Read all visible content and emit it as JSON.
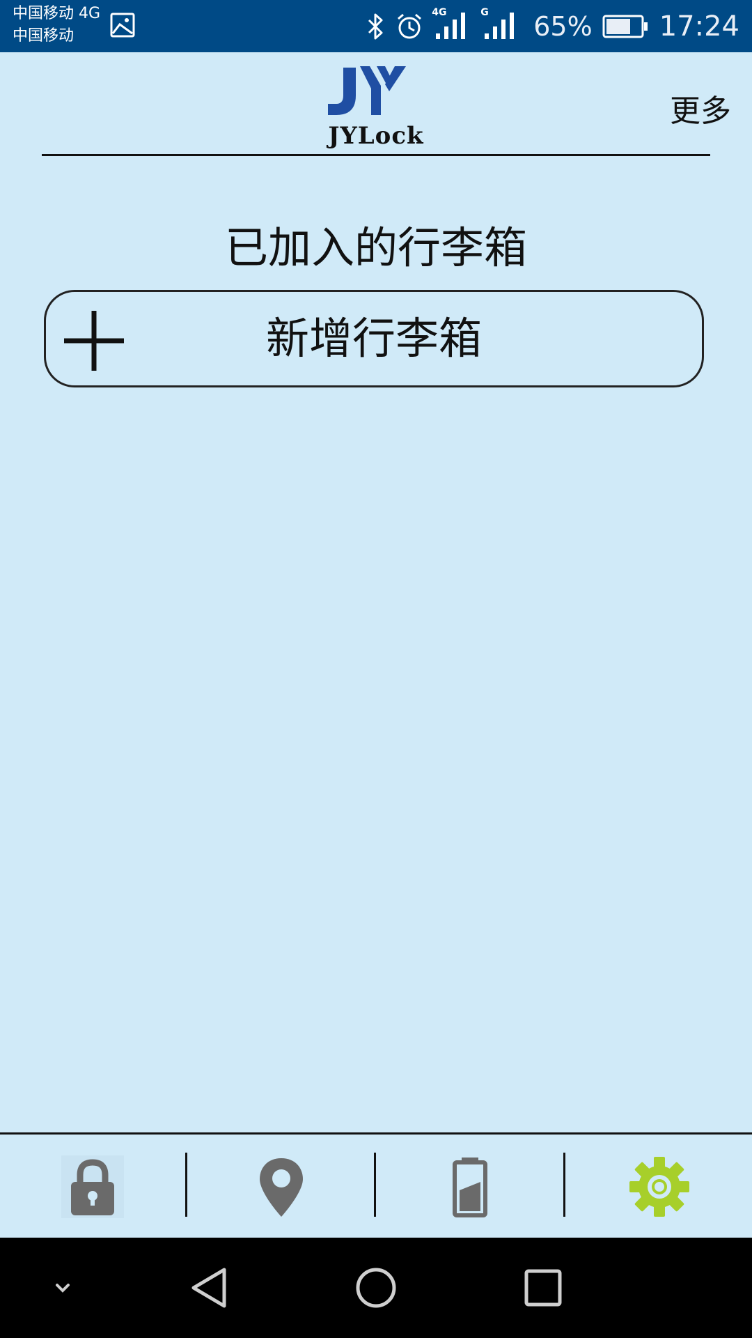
{
  "status_bar": {
    "carrier_line1": "中国移动 4G",
    "carrier_line2": "中国移动",
    "network_label_1": "4G",
    "network_label_2": "G",
    "battery_percent": "65%",
    "time": "17:24",
    "icons": [
      "gallery-icon",
      "bluetooth-icon",
      "alarm-icon",
      "signal-icon",
      "signal-icon",
      "battery-icon"
    ]
  },
  "header": {
    "logo_text": "JYLock",
    "more_label": "更多"
  },
  "main": {
    "section_title": "已加入的行李箱",
    "add_button_label": "新增行李箱"
  },
  "tab_bar": {
    "tabs": [
      {
        "icon": "lock-icon",
        "color": "#6a6a6a"
      },
      {
        "icon": "location-pin-icon",
        "color": "#6a6a6a"
      },
      {
        "icon": "battery-icon",
        "color": "#6a6a6a"
      },
      {
        "icon": "gear-icon",
        "color": "#a7cf2a",
        "active": true
      }
    ]
  },
  "nav_bar": {
    "buttons": [
      "chevron-down-icon",
      "back-icon",
      "home-icon",
      "recents-icon"
    ]
  },
  "colors": {
    "background": "#d0eaf8",
    "status_bar": "#004a86",
    "logo_blue": "#1f4ea3",
    "accent_green": "#a7cf2a",
    "icon_gray": "#6a6a6a"
  }
}
